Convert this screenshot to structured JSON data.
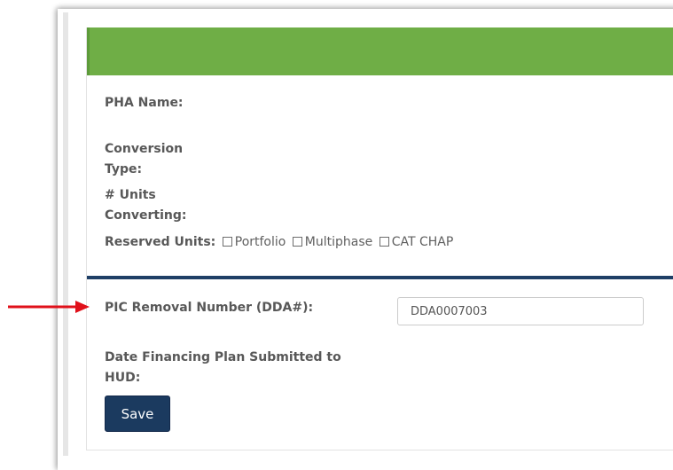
{
  "form": {
    "pha_name_label": "PHA Name:",
    "conversion_type_label_1": "Conversion",
    "conversion_type_label_2": "Type:",
    "units_converting_label_1": "# Units",
    "units_converting_label_2": "Converting:",
    "reserved_units_label": "Reserved Units:",
    "reserved_options": [
      {
        "label": "Portfolio",
        "checked": false
      },
      {
        "label": "Multiphase",
        "checked": false
      },
      {
        "label": "CAT CHAP",
        "checked": false
      }
    ],
    "pic_removal_label": "PIC Removal Number (DDA#):",
    "pic_removal_value": "DDA0007003",
    "date_financing_label_1": "Date Financing Plan Submitted to",
    "date_financing_label_2": "HUD:",
    "save_label": "Save"
  },
  "colors": {
    "header_green": "#6fae46",
    "divider_navy": "#1f3f66",
    "save_button": "#1b3a5f",
    "annotation_arrow": "#e0101a"
  },
  "annotation": {
    "icon": "red-arrow-icon",
    "points_to": "pic-removal-label"
  }
}
